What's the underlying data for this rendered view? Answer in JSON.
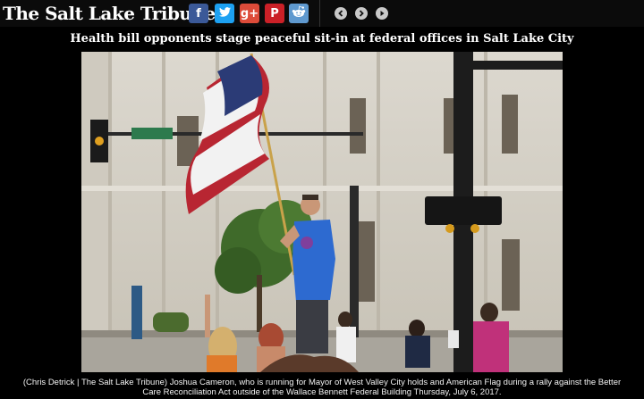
{
  "header": {
    "logo_text": "The Salt Lake Tribune",
    "share": [
      {
        "name": "facebook",
        "glyph": "f",
        "color": "#3b5998"
      },
      {
        "name": "twitter",
        "glyph": "t",
        "color": "#1da1f2"
      },
      {
        "name": "google-plus",
        "glyph": "g+",
        "color": "#dd4b39"
      },
      {
        "name": "pinterest",
        "glyph": "P",
        "color": "#cb2027"
      },
      {
        "name": "reddit",
        "glyph": "r",
        "color": "#5f99cf"
      }
    ],
    "nav": [
      "previous",
      "next",
      "play"
    ]
  },
  "article": {
    "headline": "Health bill opponents stage peaceful sit-in at federal offices in Salt Lake City"
  },
  "photo": {
    "subject": "Man holding American flag on pole at street rally"
  },
  "caption": {
    "text": "(Chris Detrick | The Salt Lake Tribune) Joshua Cameron, who is running for Mayor of West Valley City holds and American Flag during a rally against the Better Care Reconciliation Act outside of the Wallace Bennett Federal Building Thursday, July 6, 2017."
  }
}
